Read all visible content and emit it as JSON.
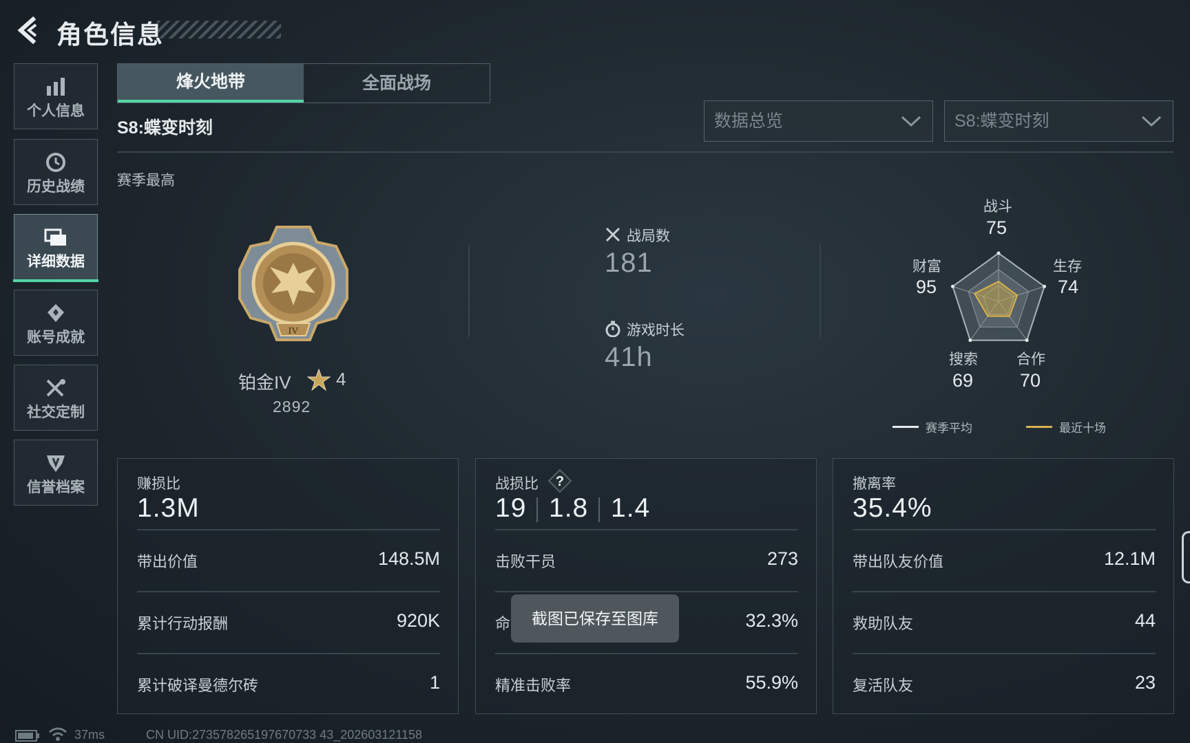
{
  "header": {
    "title": "角色信息"
  },
  "sidebar": {
    "items": [
      {
        "label": "个人信息",
        "icon": "bar-chart-icon",
        "active": false
      },
      {
        "label": "历史战绩",
        "icon": "history-icon",
        "active": false
      },
      {
        "label": "详细数据",
        "icon": "cards-icon",
        "active": true
      },
      {
        "label": "账号成就",
        "icon": "achievement-icon",
        "active": false
      },
      {
        "label": "社交定制",
        "icon": "tools-icon",
        "active": false
      },
      {
        "label": "信誉档案",
        "icon": "shield-icon",
        "active": false
      }
    ]
  },
  "tabs": [
    {
      "label": "烽火地带",
      "active": true
    },
    {
      "label": "全面战场",
      "active": false
    }
  ],
  "season_title": "S8:蝶变时刻",
  "filters": {
    "view": "数据总览",
    "season": "S8:蝶变时刻"
  },
  "season_best_label": "赛季最高",
  "rank": {
    "name": "铂金IV",
    "stars": "4",
    "points": "2892"
  },
  "matches": {
    "label": "战局数",
    "value": "181"
  },
  "playtime": {
    "label": "游戏时长",
    "value": "41h"
  },
  "radar": {
    "combat": {
      "label": "战斗",
      "value": "75"
    },
    "survival": {
      "label": "生存",
      "value": "74"
    },
    "cooperation": {
      "label": "合作",
      "value": "70"
    },
    "search": {
      "label": "搜索",
      "value": "69"
    },
    "wealth": {
      "label": "财富",
      "value": "95"
    },
    "legend": {
      "season_avg": "赛季平均",
      "recent_ten": "最近十场"
    },
    "colors": {
      "season_avg": "#e6eaec",
      "recent_ten": "#d9b34a"
    }
  },
  "panels": {
    "profit": {
      "label": "赚损比",
      "value": "1.3M",
      "rows": [
        {
          "label": "带出价值",
          "value": "148.5M"
        },
        {
          "label": "累计行动报酬",
          "value": "920K"
        },
        {
          "label": "累计破译曼德尔砖",
          "value": "1"
        }
      ]
    },
    "kd": {
      "label": "战损比",
      "help": "?",
      "values": [
        "19",
        "1.8",
        "1.4"
      ],
      "rows": [
        {
          "label": "击败干员",
          "value": "273"
        },
        {
          "label": "命",
          "value": "32.3%"
        },
        {
          "label": "精准击败率",
          "value": "55.9%"
        }
      ]
    },
    "extract": {
      "label": "撤离率",
      "value": "35.4%",
      "rows": [
        {
          "label": "带出队友价值",
          "value": "12.1M"
        },
        {
          "label": "救助队友",
          "value": "44"
        },
        {
          "label": "复活队友",
          "value": "23"
        }
      ]
    }
  },
  "toast": "截图已保存至图库",
  "footer": {
    "ping": "37ms",
    "uid": "CN UID:273578265197670733 43_202603121158"
  },
  "accent_color": "#53d6a6"
}
